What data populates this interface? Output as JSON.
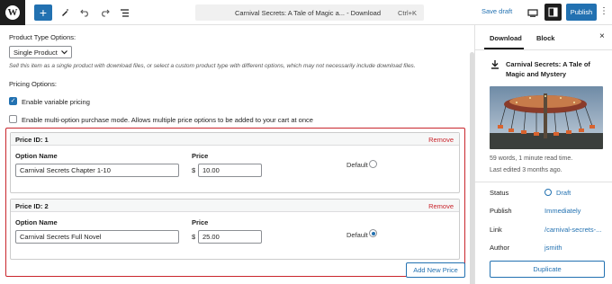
{
  "topbar": {
    "wp_logo": "W",
    "add": "+",
    "doc_title": "Carnival Secrets: A Tale of Magic a... - Download",
    "shortcut": "Ctrl+K",
    "save_draft": "Save draft",
    "publish": "Publish"
  },
  "main": {
    "product_type_label": "Product Type Options:",
    "product_type_value": "Single Product",
    "product_type_help": "Sell this item as a single product with download files, or select a custom product type with different options, which may not necessarily include download files.",
    "pricing_label": "Pricing Options:",
    "variable_pricing_label": "Enable variable pricing",
    "variable_pricing_checked": true,
    "multi_option_label": "Enable multi-option purchase mode. Allows multiple price options to be added to your cart at once",
    "multi_option_checked": false,
    "prices": [
      {
        "id_label": "Price ID: 1",
        "remove": "Remove",
        "option_name_label": "Option Name",
        "option_name": "Carnival Secrets Chapter 1-10",
        "price_label": "Price",
        "currency": "$",
        "price": "10.00",
        "default_label": "Default",
        "is_default": false
      },
      {
        "id_label": "Price ID: 2",
        "remove": "Remove",
        "option_name_label": "Option Name",
        "option_name": "Carnival Secrets Full Novel",
        "price_label": "Price",
        "currency": "$",
        "price": "25.00",
        "default_label": "Default",
        "is_default": true
      }
    ],
    "add_new_price": "Add New Price"
  },
  "sidebar": {
    "tab_download": "Download",
    "tab_block": "Block",
    "close": "×",
    "post_title": "Carnival Secrets: A Tale of Magic and Mystery",
    "words": "59 words, 1 minute read time.",
    "last_edited": "Last edited 3 months ago.",
    "status_label": "Status",
    "status_value": "Draft",
    "publish_label": "Publish",
    "publish_value": "Immediately",
    "link_label": "Link",
    "link_value": "/carnival-secrets-...",
    "author_label": "Author",
    "author_value": "jsmith",
    "duplicate": "Duplicate"
  },
  "colors": {
    "accent": "#2271b1",
    "highlight_border": "#c9252c",
    "remove": "#c9252c"
  }
}
